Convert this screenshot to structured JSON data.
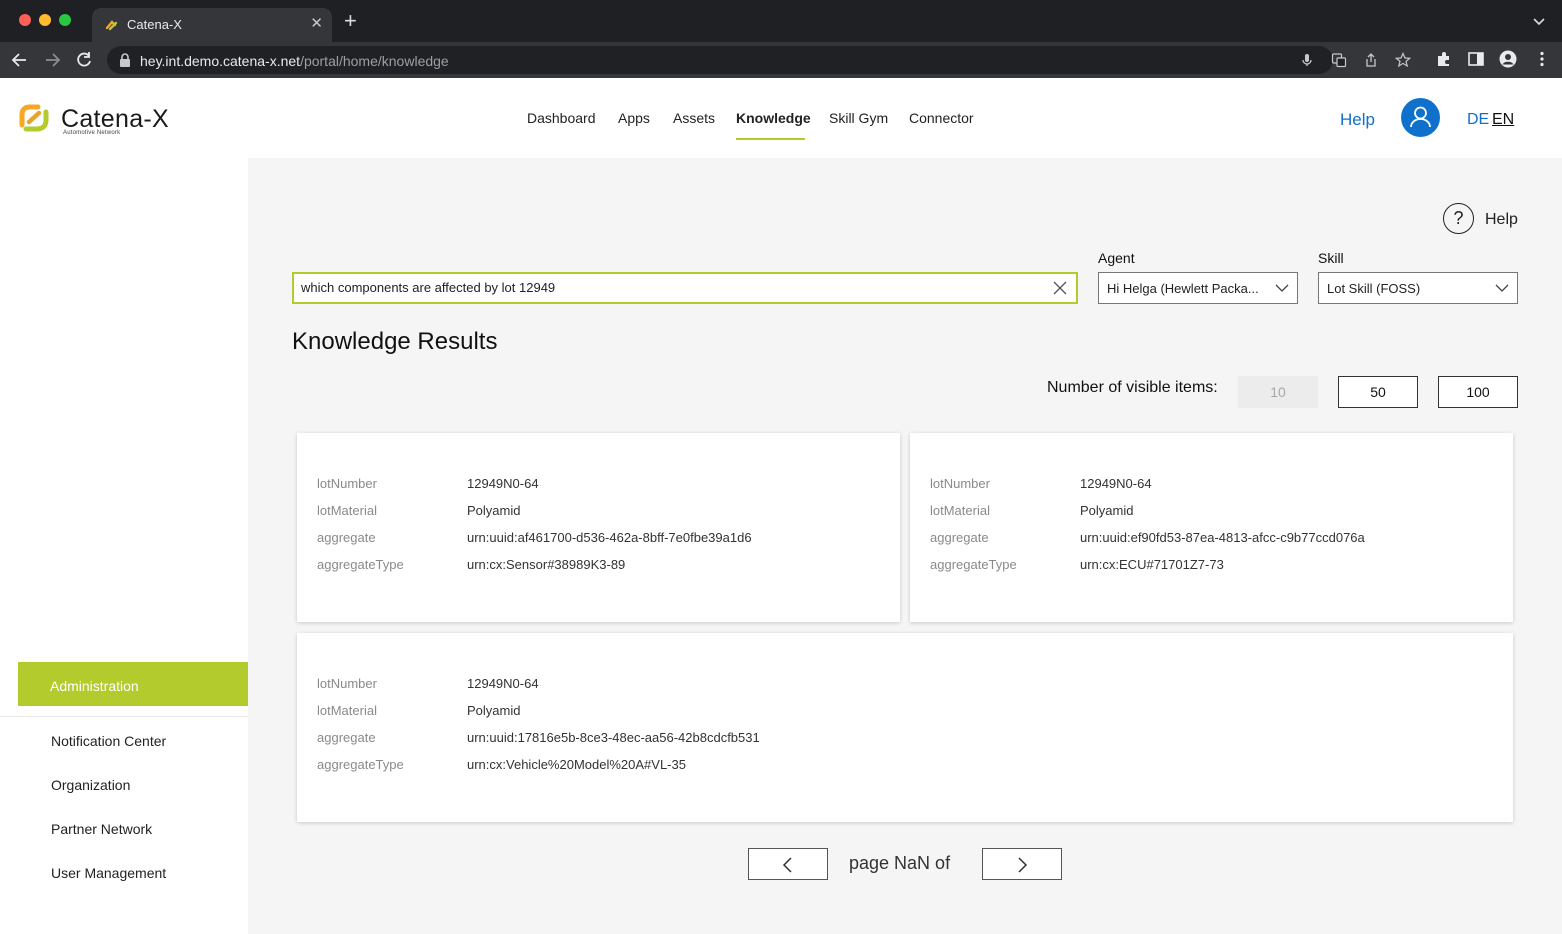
{
  "browser": {
    "tab_title": "Catena-X",
    "url_host": "hey.int.demo.catena-x.net",
    "url_path": "/portal/home/knowledge"
  },
  "header": {
    "brand": "Catena-X",
    "brand_sub": "Automotive Network",
    "nav": [
      "Dashboard",
      "Apps",
      "Assets",
      "Knowledge",
      "Skill Gym",
      "Connector"
    ],
    "active_nav": "Knowledge",
    "help": "Help",
    "lang_de": "DE",
    "lang_en": "EN"
  },
  "sidebar": {
    "admin": "Administration",
    "items": [
      "Notification Center",
      "Organization",
      "Partner Network",
      "User Management"
    ]
  },
  "main": {
    "help": "Help",
    "help_symbol": "?",
    "search_value": "which components are affected by lot 12949",
    "agent_label": "Agent",
    "agent_value": "Hi Helga (Hewlett Packa...",
    "skill_label": "Skill",
    "skill_value": "Lot Skill (FOSS)",
    "results_title": "Knowledge Results",
    "visible_label": "Number of visible items:",
    "counts": [
      "10",
      "50",
      "100"
    ],
    "page_text": "page NaN of"
  },
  "results": [
    {
      "keys": [
        "lotNumber",
        "lotMaterial",
        "aggregate",
        "aggregateType"
      ],
      "values": [
        "12949N0-64",
        "Polyamid",
        "urn:uuid:af461700-d536-462a-8bff-7e0fbe39a1d6",
        "urn:cx:Sensor#38989K3-89"
      ]
    },
    {
      "keys": [
        "lotNumber",
        "lotMaterial",
        "aggregate",
        "aggregateType"
      ],
      "values": [
        "12949N0-64",
        "Polyamid",
        "urn:uuid:ef90fd53-87ea-4813-afcc-c9b77ccd076a",
        "urn:cx:ECU#71701Z7-73"
      ]
    },
    {
      "keys": [
        "lotNumber",
        "lotMaterial",
        "aggregate",
        "aggregateType"
      ],
      "values": [
        "12949N0-64",
        "Polyamid",
        "urn:uuid:17816e5b-8ce3-48ec-aa56-42b8cdcfb531",
        "urn:cx:Vehicle%20Model%20A#VL-35"
      ]
    }
  ],
  "colors": {
    "accent_green": "#b3cb2d",
    "link_blue": "#0f71cb",
    "page_bg": "#f5f5f5"
  },
  "icons": {
    "search_clear": "close-icon",
    "avatar": "user-icon",
    "help": "help-circle-icon",
    "prev": "chevron-left-icon",
    "next": "chevron-right-icon"
  }
}
